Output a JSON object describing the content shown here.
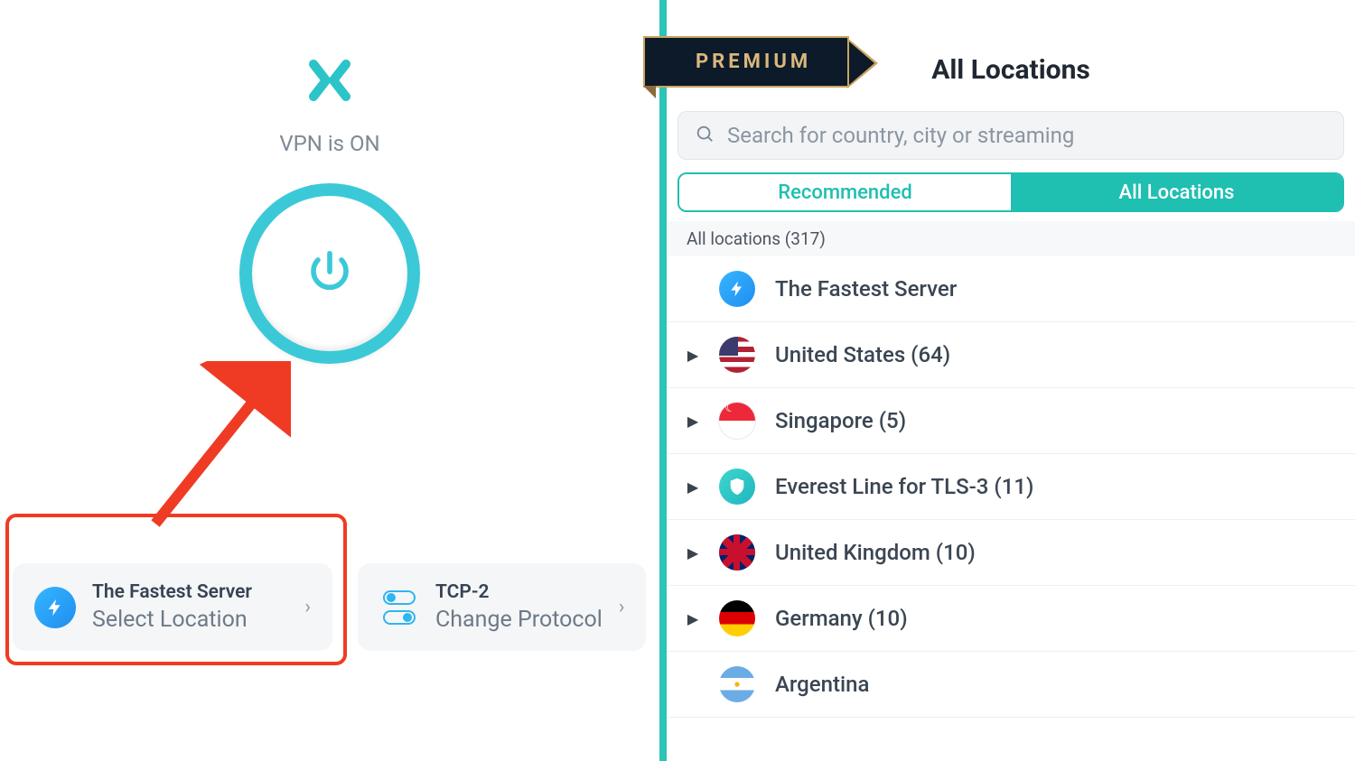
{
  "left": {
    "status": "VPN is ON",
    "location_card": {
      "title": "The Fastest Server",
      "subtitle": "Select Location"
    },
    "protocol_card": {
      "title": "TCP-2",
      "subtitle": "Change Protocol"
    }
  },
  "right": {
    "premium_label": "PREMIUM",
    "title": "All Locations",
    "search_placeholder": "Search for country, city or streaming",
    "tabs": {
      "recommended": "Recommended",
      "all": "All Locations"
    },
    "section_label": "All locations (317)",
    "rows": [
      {
        "label": "The Fastest Server",
        "expandable": false,
        "flag": "bolt"
      },
      {
        "label": "United States (64)",
        "expandable": true,
        "flag": "us"
      },
      {
        "label": "Singapore (5)",
        "expandable": true,
        "flag": "sg"
      },
      {
        "label": "Everest Line for TLS-3 (11)",
        "expandable": true,
        "flag": "shield"
      },
      {
        "label": "United Kingdom (10)",
        "expandable": true,
        "flag": "uk"
      },
      {
        "label": "Germany (10)",
        "expandable": true,
        "flag": "de"
      },
      {
        "label": "Argentina",
        "expandable": false,
        "flag": "ar"
      }
    ]
  }
}
